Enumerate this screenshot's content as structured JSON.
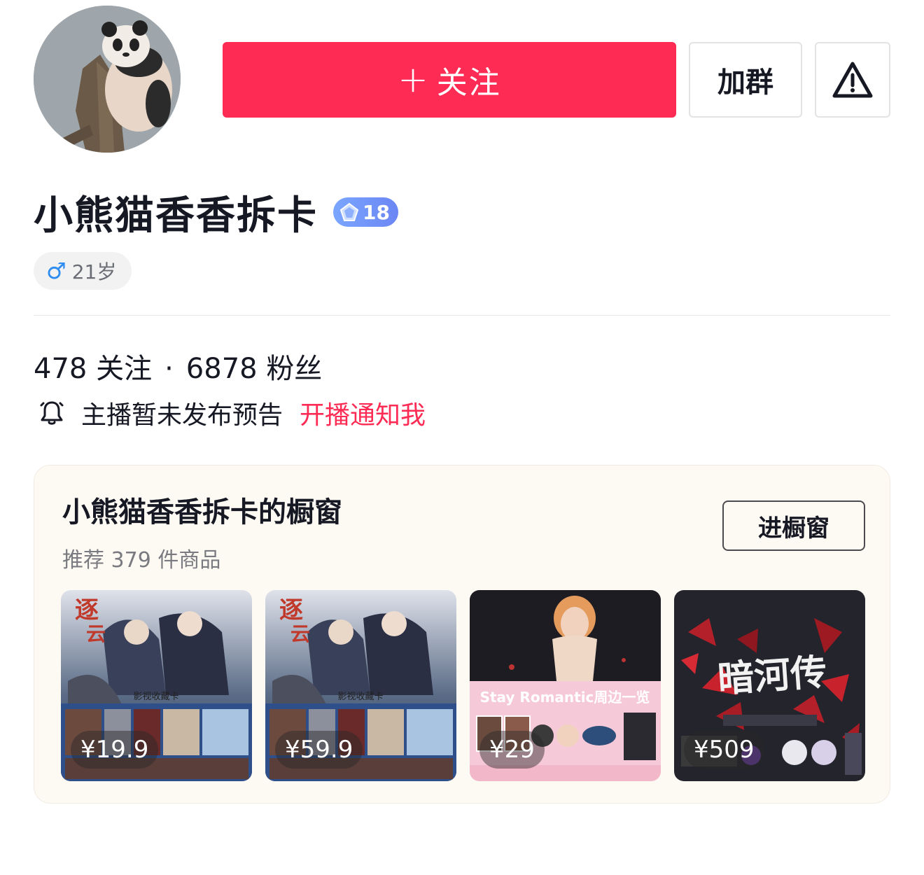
{
  "header": {
    "follow_label": "关注",
    "follow_plus": "+",
    "group_label": "加群"
  },
  "profile": {
    "name": "小熊猫香香拆卡",
    "level": "18",
    "gender_symbol": "♂",
    "age": "21岁"
  },
  "stats": {
    "following_count": "478",
    "following_label": "关注",
    "separator": "·",
    "followers_count": "6878",
    "followers_label": "粉丝"
  },
  "live_notice": {
    "text": "主播暂未发布预告",
    "link": "开播通知我"
  },
  "shop": {
    "title": "小熊猫香香拆卡的橱窗",
    "subtitle": "推荐 379 件商品",
    "enter_label": "进橱窗",
    "products": [
      {
        "price": "¥19.9",
        "image_text": "影视收藏卡"
      },
      {
        "price": "¥59.9",
        "image_text": "影视收藏卡"
      },
      {
        "price": "¥29",
        "image_text": "Stay Romantic周边一览"
      },
      {
        "price": "¥509",
        "image_text": "暗河传"
      }
    ]
  },
  "colors": {
    "brand_red": "#fe2c55",
    "level_blue": "#6b86f4",
    "male_blue": "#2d8cf0"
  },
  "icons": {
    "report": "warning-triangle-icon",
    "bell": "bell-icon",
    "level": "diamond-icon"
  }
}
